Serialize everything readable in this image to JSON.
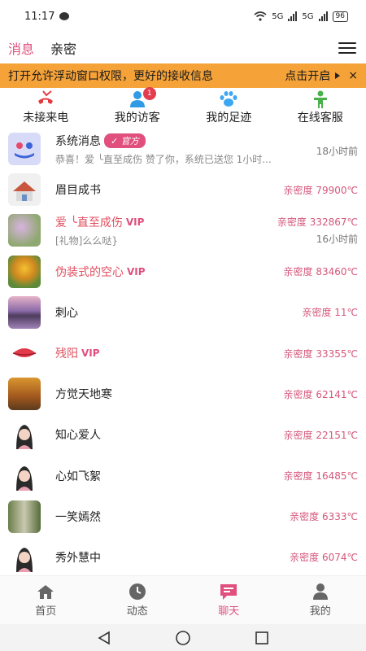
{
  "status": {
    "time": "11:17",
    "battery": "96",
    "net1": "5G",
    "net2": "5G"
  },
  "tabs": [
    {
      "label": "消息"
    },
    {
      "label": "亲密"
    }
  ],
  "banner": {
    "text": "打开允许浮动窗口权限，更好的接收信息",
    "action": "点击开启",
    "close": "×"
  },
  "quick": [
    {
      "label": "未接来电",
      "icon": "missed-call-icon"
    },
    {
      "label": "我的访客",
      "icon": "visitor-icon",
      "badge": "1"
    },
    {
      "label": "我的足迹",
      "icon": "paw-icon"
    },
    {
      "label": "在线客服",
      "icon": "customer-service-icon"
    }
  ],
  "messages": [
    {
      "name": "系统消息",
      "tag": "官方",
      "preview": "恭喜！爱 ╰直至成伤 赞了你，系统已送您 1小时...",
      "time": "18小时前",
      "avatar": "system",
      "vip": false
    },
    {
      "name": "眉目成书",
      "intimacy": "亲密度 79900℃",
      "avatar": "house",
      "vip": false
    },
    {
      "name": "爱 ╰直至成伤",
      "vip_label": "VIP",
      "preview": "[礼物]么么哒}",
      "intimacy": "亲密度 332867℃",
      "time": "16小时前",
      "avatar": "flowers",
      "vip": true
    },
    {
      "name": "伪装式的空心",
      "vip_label": "VIP",
      "intimacy": "亲密度 83460℃",
      "avatar": "sunflower",
      "vip": true
    },
    {
      "name": "刺心",
      "intimacy": "亲密度 11℃",
      "avatar": "lake",
      "vip": false
    },
    {
      "name": "残阳",
      "vip_label": "VIP",
      "intimacy": "亲密度 33355℃",
      "avatar": "lips",
      "vip": true
    },
    {
      "name": "方觉天地寒",
      "intimacy": "亲密度 62141℃",
      "avatar": "autumn",
      "vip": false
    },
    {
      "name": "知心爱人",
      "intimacy": "亲密度 22151℃",
      "avatar": "girl",
      "vip": false
    },
    {
      "name": "心如飞絮",
      "intimacy": "亲密度 16485℃",
      "avatar": "girl",
      "vip": false
    },
    {
      "name": "一笑嫣然",
      "intimacy": "亲密度 6333℃",
      "avatar": "tree",
      "vip": false
    },
    {
      "name": "秀外慧中",
      "intimacy": "亲密度 6074℃",
      "avatar": "girl",
      "vip": false
    }
  ],
  "nav": [
    {
      "label": "首页",
      "icon": "home-icon"
    },
    {
      "label": "动态",
      "icon": "clock-icon"
    },
    {
      "label": "聊天",
      "icon": "chat-icon",
      "active": true
    },
    {
      "label": "我的",
      "icon": "person-icon"
    }
  ],
  "colors": {
    "accent": "#e04f7e",
    "banner": "#f5a238"
  }
}
